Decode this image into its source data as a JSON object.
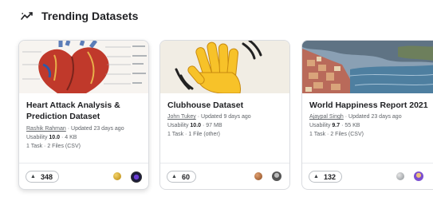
{
  "section": {
    "title": "Trending Datasets",
    "icon": "trending-line-icon"
  },
  "cards": [
    {
      "title": "Heart Attack Analysis & Prediction Dataset",
      "author": "Rashik Rahman",
      "updated": "· Updated 23 days ago",
      "usability_label": "Usability",
      "usability": "10.0",
      "size": "· 4 KB",
      "files": "1 Task · 2 Files (CSV)",
      "votes": "348",
      "medal_color": "#c9a227",
      "thumbnail": "heart-anatomy-image"
    },
    {
      "title": "Clubhouse Dataset",
      "author": "John Tukey",
      "updated": "· Updated 9 days ago",
      "usability_label": "Usability",
      "usability": "10.0",
      "size": "· 97 MB",
      "files": "1 Task · 1 File (other)",
      "votes": "60",
      "medal_color": "#b87333",
      "thumbnail": "waving-hand-image"
    },
    {
      "title": "World Happiness Report 2021",
      "author": "Ajaypal Singh",
      "updated": "· Updated 23 days ago",
      "usability_label": "Usability",
      "usability": "9.7",
      "size": "· 55 KB",
      "files": "1 Task · 2 Files (CSV)",
      "votes": "132",
      "medal_color": "#9aa0a6",
      "thumbnail": "coastal-town-image"
    }
  ]
}
